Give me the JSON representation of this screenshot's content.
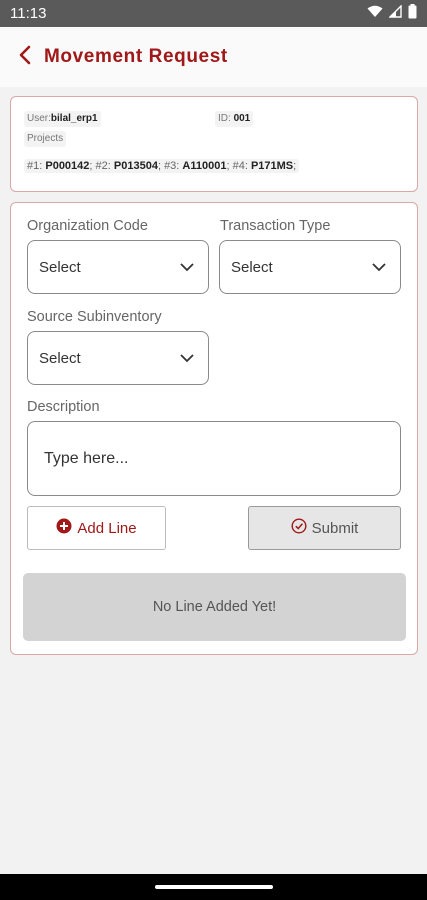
{
  "status_bar": {
    "time": "11:13",
    "icons": [
      "wifi-icon",
      "signal-icon",
      "battery-icon"
    ]
  },
  "header": {
    "back_icon": "chevron-left-icon",
    "title": "Movement Request"
  },
  "info": {
    "user_label": "User:",
    "user_value": "bilal_erp1",
    "id_label": "ID: ",
    "id_value": "001",
    "projects_label": "Projects",
    "projects": [
      {
        "prefix": "#1: ",
        "code": "P000142",
        "sep": "; "
      },
      {
        "prefix": "#2: ",
        "code": "P013504",
        "sep": "; "
      },
      {
        "prefix": "#3: ",
        "code": "A110001",
        "sep": "; "
      },
      {
        "prefix": "#4: ",
        "code": "P171MS",
        "sep": ";"
      }
    ]
  },
  "form": {
    "organization_code": {
      "label": "Organization Code",
      "value": "Select"
    },
    "transaction_type": {
      "label": "Transaction Type",
      "value": "Select"
    },
    "source_subinventory": {
      "label": "Source Subinventory",
      "value": "Select"
    },
    "description": {
      "label": "Description",
      "placeholder": "Type here..."
    },
    "add_line_label": "Add Line",
    "submit_label": "Submit",
    "empty_message": "No Line Added Yet!"
  },
  "colors": {
    "accent": "#a01818",
    "card_border": "#d9a7a7",
    "status_bar": "#5a5a5a",
    "background": "#f2f2f2"
  }
}
